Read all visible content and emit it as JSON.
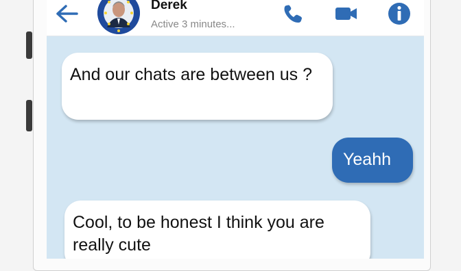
{
  "header": {
    "contact_name": "Derek",
    "status": "Active 3 minutes...",
    "icons": [
      "back-arrow-icon",
      "phone-icon",
      "video-camera-icon",
      "info-icon"
    ]
  },
  "messages": [
    {
      "direction": "incoming",
      "text": "And our chats are between us ?"
    },
    {
      "direction": "outgoing",
      "text": "Yeahh"
    },
    {
      "direction": "incoming",
      "text": "Cool, to be honest I think you are really cute"
    }
  ],
  "colors": {
    "accent": "#2f6cb5",
    "chat_background": "#d3e6f3",
    "incoming_bubble": "#ffffff",
    "outgoing_bubble": "#2f6cb5",
    "status_text": "#888888"
  }
}
